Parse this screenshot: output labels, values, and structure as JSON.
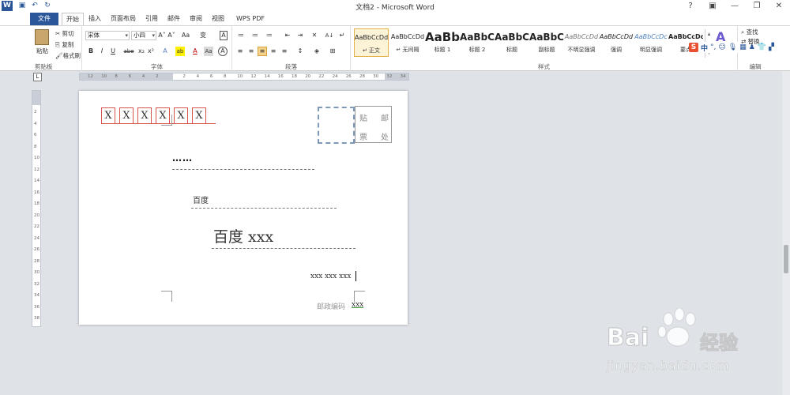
{
  "window": {
    "title": "文档2 - Microsoft Word",
    "minimize": "—",
    "restore": "❐",
    "close": "✕"
  },
  "qat": {
    "save": "▣",
    "undo": "↶",
    "redo": "↻"
  },
  "tabs": [
    "文件",
    "开始",
    "插入",
    "页面布局",
    "引用",
    "邮件",
    "审阅",
    "视图",
    "WPS PDF"
  ],
  "clipboard": {
    "paste": "粘贴",
    "cut": "剪切",
    "copy": "复制",
    "format_painter": "格式刷",
    "group_label": "剪贴板"
  },
  "font": {
    "family": "宋体",
    "size": "小四",
    "group_label": "字体",
    "row1": [
      "A˄",
      "A˅",
      "Aa",
      "变",
      "A"
    ],
    "row2": [
      "B",
      "I",
      "U",
      "abe",
      "x₂",
      "x²",
      "A",
      "ab",
      "A",
      "Aa",
      "A"
    ]
  },
  "paragraph": {
    "group_label": "段落",
    "row1": [
      "≔",
      "≔",
      "≔",
      "⇤",
      "⇥",
      "✕",
      "A↓",
      "↵"
    ],
    "row2": [
      "≡",
      "≡",
      "≡",
      "≡",
      "≡",
      "↕",
      "◈",
      "⊞"
    ]
  },
  "styles": {
    "group_label": "样式",
    "items": [
      {
        "sample": "AaBbCcDd",
        "name": "↵ 正文"
      },
      {
        "sample": "AaBbCcDd",
        "name": "↵ 无间隔"
      },
      {
        "sample": "AaBb",
        "name": "标题 1"
      },
      {
        "sample": "AaBbC",
        "name": "标题 2"
      },
      {
        "sample": "AaBbC",
        "name": "标题"
      },
      {
        "sample": "AaBbC",
        "name": "副标题"
      },
      {
        "sample": "AaBbCcDd",
        "name": "不明显强调"
      },
      {
        "sample": "AaBbCcDd",
        "name": "强调"
      },
      {
        "sample": "AaBbCcDc",
        "name": "明显强调"
      },
      {
        "sample": "AaBbCcDc",
        "name": "要点"
      }
    ]
  },
  "editing": {
    "find": "查找",
    "replace": "替换",
    "group_label": "编辑"
  },
  "ime": {
    "label": "中"
  },
  "ruler": {
    "h_labels": [
      "12",
      "10",
      "8",
      "6",
      "4",
      "2",
      "",
      "2",
      "4",
      "6",
      "8",
      "10",
      "12",
      "14",
      "16",
      "18",
      "20",
      "22",
      "24",
      "26",
      "28",
      "30",
      "32",
      "34"
    ],
    "v_labels": [
      "2",
      "4",
      "6",
      "8",
      "10",
      "12",
      "14",
      "16",
      "18",
      "20",
      "22",
      "24",
      "26",
      "28",
      "30",
      "32",
      "34",
      "36",
      "38"
    ]
  },
  "document": {
    "postal_boxes": [
      "X",
      "X",
      "X",
      "X",
      "X",
      "X"
    ],
    "stamp_chars": [
      "贴",
      "邮",
      "票",
      "处"
    ],
    "dots": "……",
    "line_baidu_small": "百度",
    "line_baidu_large": "百度 xxx",
    "sender": "xxx xxx xxx",
    "postcode_label": "邮政编码",
    "postcode_value": "xxx"
  },
  "watermark": {
    "brand": "Bai",
    "brand_cn": "经验",
    "url": "jingyan.baidu.com"
  },
  "colors": {
    "accent": "#2b579a",
    "box_red": "#d9534f",
    "stamp_dash": "#7d98b8"
  }
}
